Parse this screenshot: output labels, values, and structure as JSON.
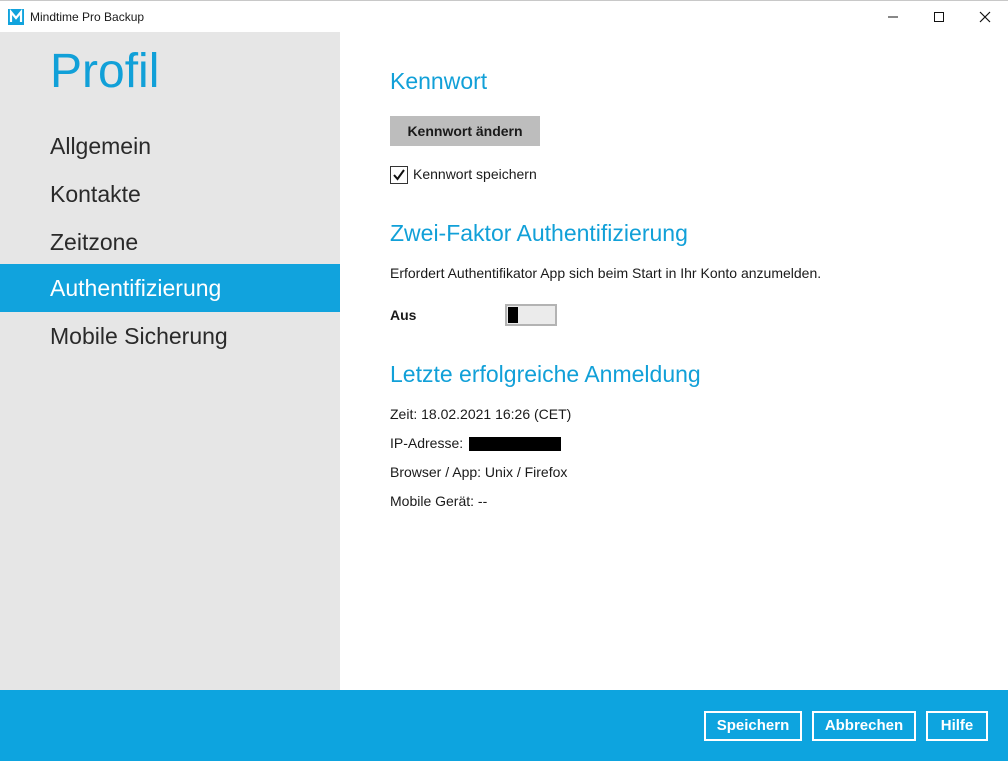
{
  "window": {
    "title": "Mindtime Pro Backup",
    "minimize_icon": "minimize-icon",
    "maximize_icon": "maximize-icon",
    "close_icon": "close-icon"
  },
  "sidebar": {
    "title": "Profil",
    "items": [
      {
        "label": "Allgemein",
        "active": false
      },
      {
        "label": "Kontakte",
        "active": false
      },
      {
        "label": "Zeitzone",
        "active": false
      },
      {
        "label": "Authentifizierung",
        "active": true
      },
      {
        "label": "Mobile Sicherung",
        "active": false
      }
    ]
  },
  "password": {
    "title": "Kennwort",
    "change_button": "Kennwort ändern",
    "save_checkbox_label": "Kennwort speichern",
    "save_checked": true
  },
  "two_factor": {
    "title": "Zwei-Faktor Authentifizierung",
    "description": "Erfordert Authentifikator App sich beim Start in Ihr Konto anzumelden.",
    "toggle_label": "Aus",
    "enabled": false
  },
  "last_login": {
    "title": "Letzte erfolgreiche Anmeldung",
    "time": "Zeit: 18.02.2021 16:26 (CET)",
    "ip_label": "IP-Adresse:",
    "browser": "Browser / App: Unix / Firefox",
    "mobile": "Mobile Gerät: --"
  },
  "footer": {
    "save": "Speichern",
    "cancel": "Abbrechen",
    "help": "Hilfe"
  },
  "colors": {
    "accent": "#11a3dd",
    "sidebar_bg": "#e6e6e6",
    "footer_bg": "#0da4df"
  }
}
